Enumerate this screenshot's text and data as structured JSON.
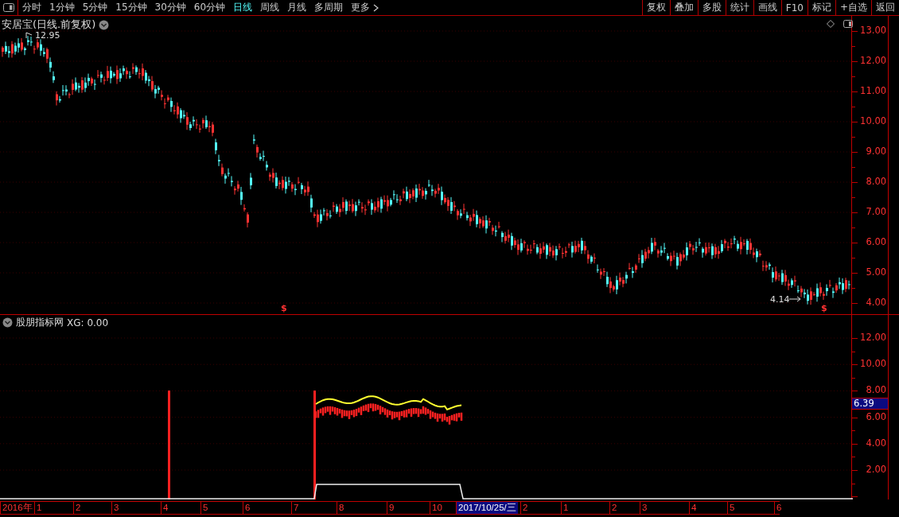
{
  "toolbar": {
    "tabs": [
      {
        "label": "分时",
        "selected": false
      },
      {
        "label": "1分钟",
        "selected": false
      },
      {
        "label": "5分钟",
        "selected": false
      },
      {
        "label": "15分钟",
        "selected": false
      },
      {
        "label": "30分钟",
        "selected": false
      },
      {
        "label": "60分钟",
        "selected": false
      },
      {
        "label": "日线",
        "selected": true
      },
      {
        "label": "周线",
        "selected": false
      },
      {
        "label": "月线",
        "selected": false
      },
      {
        "label": "多周期",
        "selected": false
      },
      {
        "label": "更多",
        "selected": false
      }
    ],
    "buttons": [
      "复权",
      "叠加",
      "多股",
      "统计",
      "画线",
      "F10",
      "标记",
      "+自选",
      "返回"
    ]
  },
  "chart": {
    "title": "安居宝(日线.前复权)",
    "high_label": "12.95",
    "low_label": "4.14",
    "markers": [
      "$",
      "$"
    ],
    "price_axis": [
      "13.00",
      "12.00",
      "11.00",
      "10.00",
      "9.00",
      "8.00",
      "7.00",
      "6.00",
      "5.00",
      "4.00"
    ]
  },
  "indicator": {
    "title": "股朋指标网",
    "reading": "XG: 0.00",
    "axis": [
      "12.00",
      "10.00",
      "8.00",
      "6.00",
      "4.00",
      "2.00"
    ],
    "current_value": "6.39"
  },
  "date_axis": [
    {
      "label": "2016年",
      "selected": false
    },
    {
      "label": "1",
      "selected": false
    },
    {
      "label": "2",
      "selected": false
    },
    {
      "label": "3",
      "selected": false
    },
    {
      "label": "4",
      "selected": false
    },
    {
      "label": "5",
      "selected": false
    },
    {
      "label": "6",
      "selected": false
    },
    {
      "label": "7",
      "selected": false
    },
    {
      "label": "8",
      "selected": false
    },
    {
      "label": "9",
      "selected": false
    },
    {
      "label": "10",
      "selected": false
    },
    {
      "label": "2017/10/25/三",
      "selected": true
    },
    {
      "label": "2",
      "selected": false
    },
    {
      "label": "1",
      "selected": false
    },
    {
      "label": "2",
      "selected": false
    },
    {
      "label": "3",
      "selected": false
    },
    {
      "label": "4",
      "selected": false
    },
    {
      "label": "5",
      "selected": false
    },
    {
      "label": "6",
      "selected": false
    }
  ]
}
